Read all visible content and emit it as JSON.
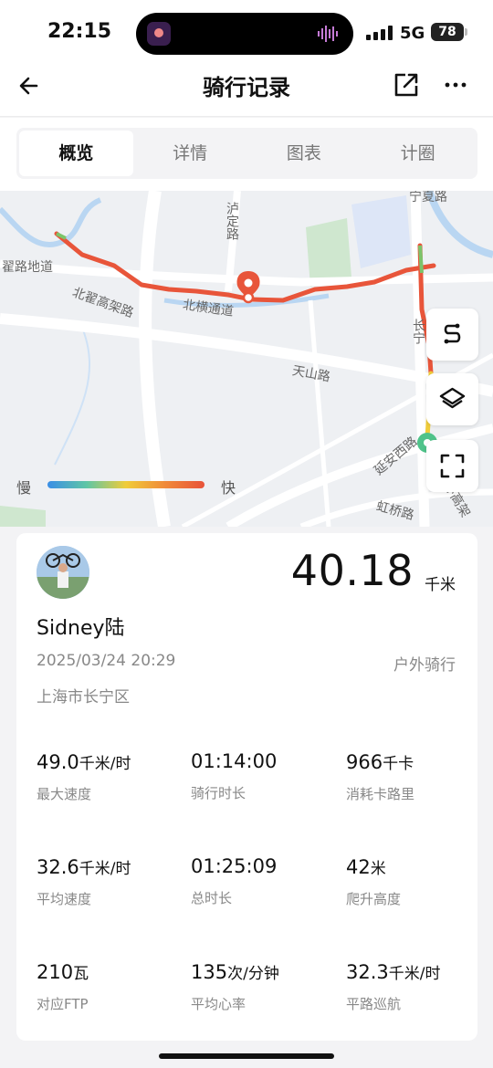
{
  "status_bar": {
    "time": "22:15",
    "network": "5G",
    "battery": "78"
  },
  "nav": {
    "title": "骑行记录",
    "back_icon": "arrow-left-icon",
    "share_icon": "share-icon",
    "more_icon": "more-icon"
  },
  "tabs": [
    {
      "label": "概览",
      "active": true
    },
    {
      "label": "详情",
      "active": false
    },
    {
      "label": "图表",
      "active": false
    },
    {
      "label": "计圈",
      "active": false
    }
  ],
  "map": {
    "labels": {
      "road_1": "翟路地道",
      "road_2": "北翟高架路",
      "road_3": "北横通道",
      "road_4": "泸定路",
      "road_5": "宁夏路",
      "road_6": "天山路",
      "road_7": "延安西路",
      "road_8": "虹桥路",
      "road_9": "长宁",
      "road_10": "环高架"
    },
    "legend": {
      "slow": "慢",
      "fast": "快"
    },
    "route_color": "#e8553a",
    "buttons": [
      "route-icon",
      "layers-icon",
      "fullscreen-icon"
    ]
  },
  "summary": {
    "distance": "40.18",
    "distance_unit": "千米",
    "username": "Sidney陆",
    "datetime": "2025/03/24 20:29",
    "activity_type": "户外骑行",
    "location": "上海市长宁区"
  },
  "stats": [
    {
      "value": "49.0",
      "unit": "千米/时",
      "label": "最大速度"
    },
    {
      "value": "01:14:00",
      "unit": "",
      "label": "骑行时长"
    },
    {
      "value": "966",
      "unit": "千卡",
      "label": "消耗卡路里"
    },
    {
      "value": "32.6",
      "unit": "千米/时",
      "label": "平均速度"
    },
    {
      "value": "01:25:09",
      "unit": "",
      "label": "总时长"
    },
    {
      "value": "42",
      "unit": "米",
      "label": "爬升高度"
    },
    {
      "value": "210",
      "unit": "瓦",
      "label": "对应FTP"
    },
    {
      "value": "135",
      "unit": "次/分钟",
      "label": "平均心率"
    },
    {
      "value": "32.3",
      "unit": "千米/时",
      "label": "平路巡航"
    }
  ]
}
